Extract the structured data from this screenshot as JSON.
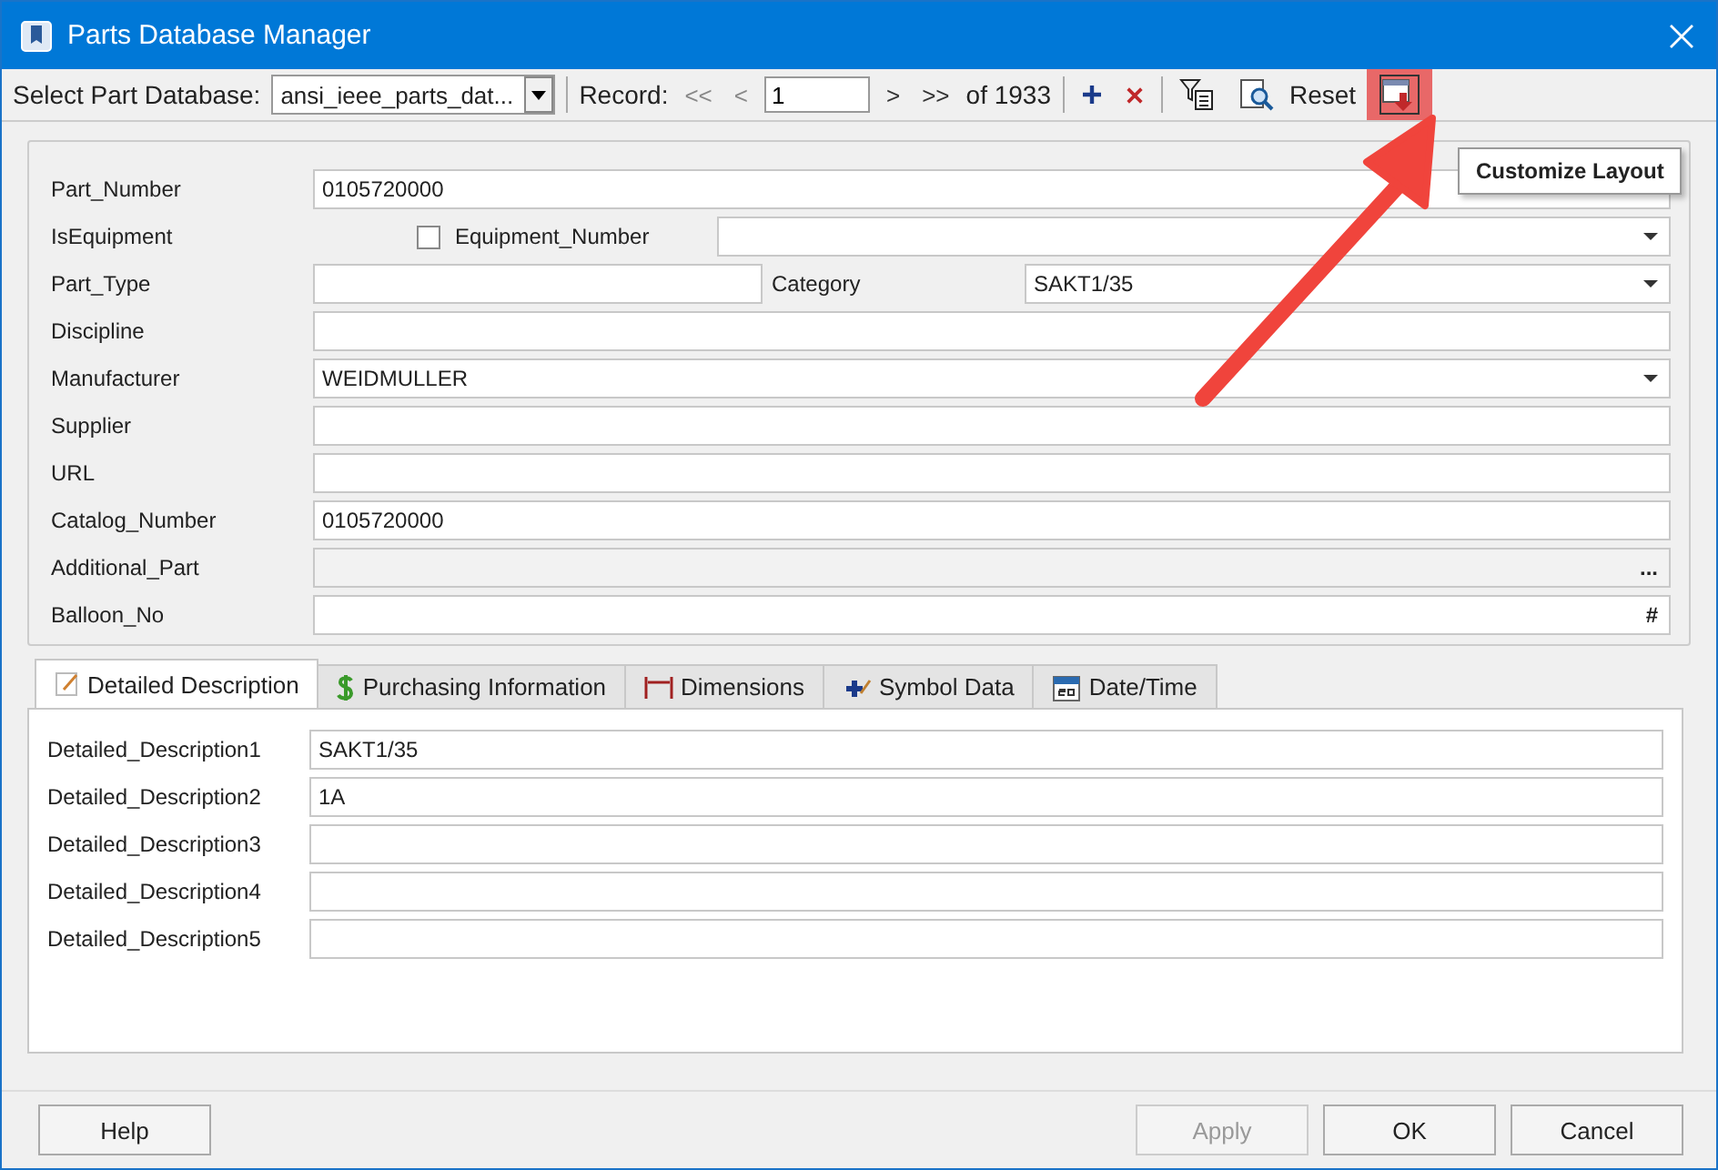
{
  "window": {
    "title": "Parts Database Manager"
  },
  "toolbar": {
    "database_label": "Select Part Database:",
    "database_value": "ansi_ieee_parts_dat...",
    "record_label": "Record:",
    "first": "<<",
    "prev": "<",
    "record_value": "1",
    "next": ">",
    "last": ">>",
    "record_count": "of 1933",
    "reset": "Reset"
  },
  "tooltip": "Customize Layout",
  "fields": [
    {
      "kind": "text",
      "label": "Part_Number",
      "value": "0105720000"
    },
    {
      "kind": "checkbox_combo",
      "label": "IsEquipment",
      "checked": false,
      "sublabel": "Equipment_Number"
    },
    {
      "kind": "text_combo",
      "label": "Part_Type",
      "sublabel": "Category",
      "value": "SAKT1/35"
    },
    {
      "kind": "text",
      "label": "Discipline"
    },
    {
      "kind": "combo",
      "label": "Manufacturer",
      "value": "WEIDMULLER"
    },
    {
      "kind": "text",
      "label": "Supplier"
    },
    {
      "kind": "text",
      "label": "URL"
    },
    {
      "kind": "text",
      "label": "Catalog_Number",
      "value": "0105720000"
    },
    {
      "kind": "browse",
      "label": "Additional_Part",
      "button": "..."
    },
    {
      "kind": "button_text",
      "label": "Balloon_No",
      "button": "#"
    }
  ],
  "tabs": [
    {
      "label": "Detailed Description",
      "selected": true
    },
    {
      "label": "Purchasing Information",
      "selected": false
    },
    {
      "label": "Dimensions",
      "selected": false
    },
    {
      "label": "Symbol Data",
      "selected": false
    },
    {
      "label": "Date/Time",
      "selected": false
    }
  ],
  "descriptions": [
    {
      "label": "Detailed_Description1",
      "value": "SAKT1/35"
    },
    {
      "label": "Detailed_Description2",
      "value": "1A"
    },
    {
      "label": "Detailed_Description3"
    },
    {
      "label": "Detailed_Description4"
    },
    {
      "label": "Detailed_Description5"
    }
  ],
  "buttons": [
    {
      "label": "Help",
      "disabled": false
    },
    {
      "label": "Apply",
      "disabled": true
    },
    {
      "label": "OK",
      "disabled": false
    },
    {
      "label": "Cancel",
      "disabled": false
    }
  ]
}
